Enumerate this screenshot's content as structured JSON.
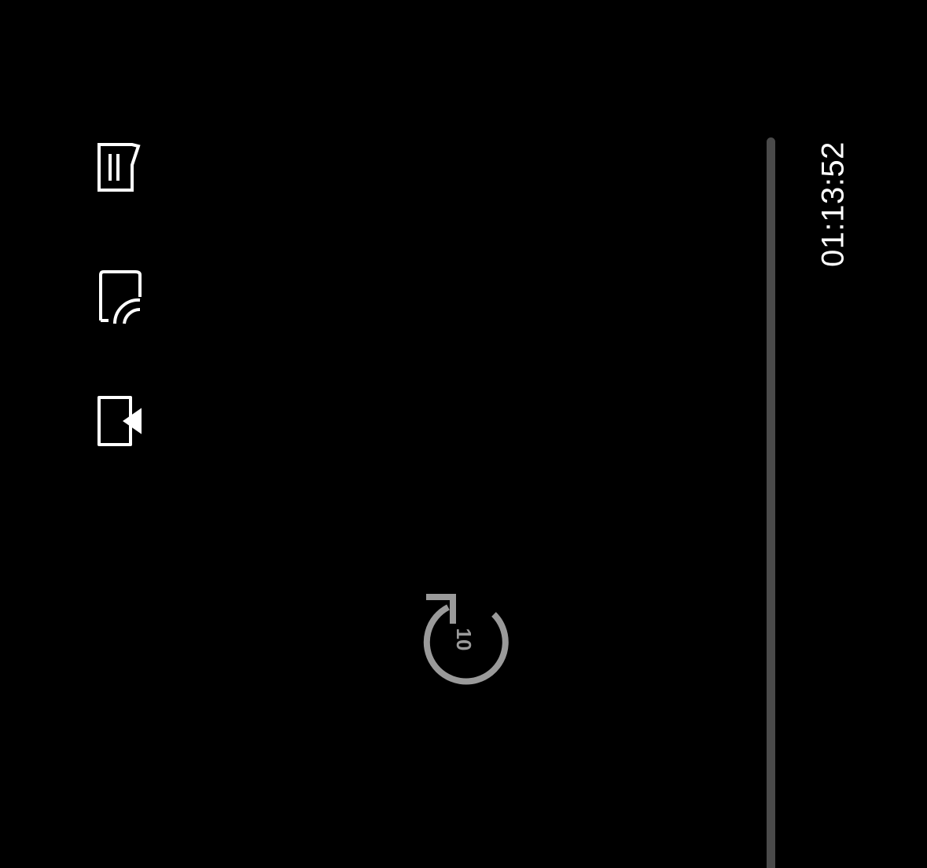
{
  "player": {
    "time_remaining": "01:13:52",
    "progress": 0.0
  },
  "controls": {
    "episodes_icon": "episodes-icon",
    "cast_icon": "cast-icon",
    "next_episode_icon": "next-episode-icon",
    "replay_icon": "replay-10-icon",
    "replay_seconds": "10"
  },
  "colors": {
    "background": "#000000",
    "icon": "#ffffff",
    "track": "#4a4a4a",
    "replay": "#9a9a9a"
  }
}
